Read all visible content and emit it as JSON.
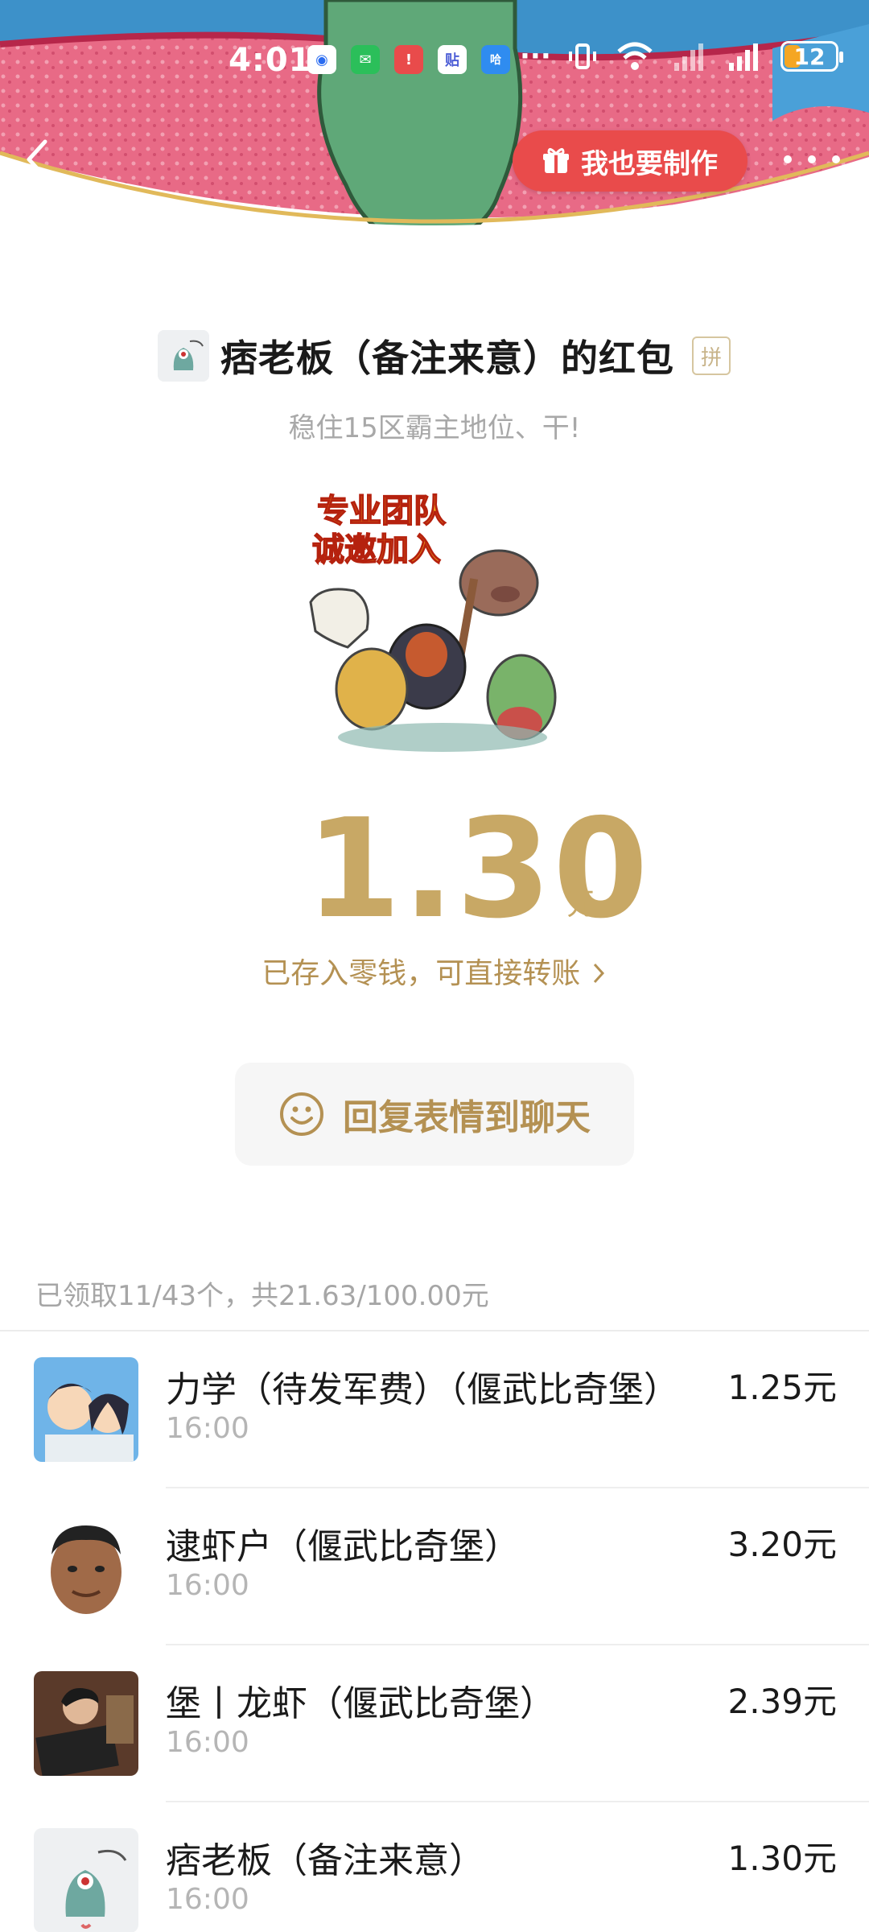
{
  "status_bar": {
    "time": "4:01",
    "battery": "12"
  },
  "header": {
    "make_button": "我也要制作"
  },
  "packet": {
    "sender_title": "痞老板（备注来意）的红包",
    "pin_badge": "拼",
    "blessing": "稳住15区霸主地位、干!",
    "sticker_caption_line1": "专业团队",
    "sticker_caption_line2": "诚邀加入",
    "amount": "1.30",
    "unit": "元",
    "saved_note": "已存入零钱，可直接转账",
    "reply_button": "回复表情到聊天"
  },
  "summary": "已领取11/43个，共21.63/100.00元",
  "records": [
    {
      "name": "力学（待发军费）（偃武比奇堡）",
      "time": "16:00",
      "amount": "1.25元"
    },
    {
      "name": "逮虾户（偃武比奇堡）",
      "time": "16:00",
      "amount": "3.20元"
    },
    {
      "name": "堡丨龙虾（偃武比奇堡）",
      "time": "16:00",
      "amount": "2.39元"
    },
    {
      "name": "痞老板（备注来意）",
      "time": "16:00",
      "amount": "1.30元"
    }
  ]
}
